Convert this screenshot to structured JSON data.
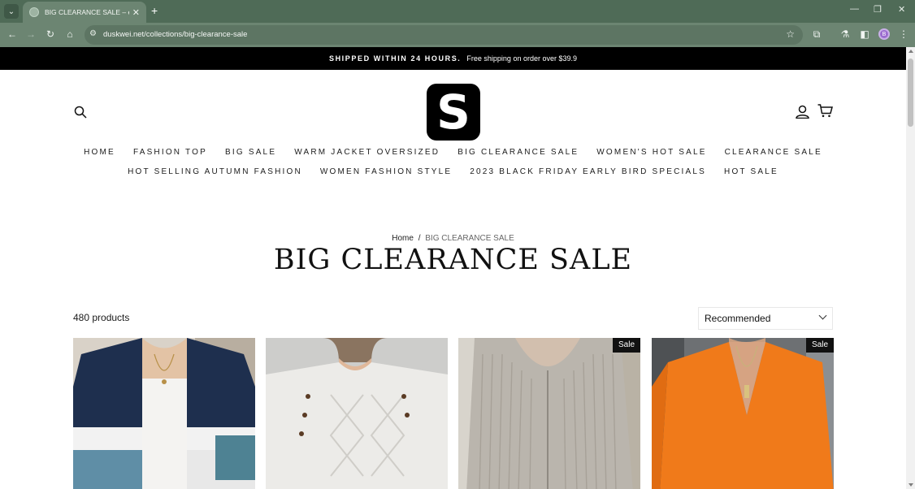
{
  "browser": {
    "tab_title": "BIG CLEARANCE SALE – establi",
    "url": "duskwei.net/collections/big-clearance-sale",
    "profile_initial": "B"
  },
  "announcement": {
    "bold_text": "SHIPPED WITHIN 24 HOURS.",
    "text": "Free shipping on order over $39.9"
  },
  "logo_letter": "S",
  "nav": {
    "row1": [
      "HOME",
      "FASHION TOP",
      "BIG SALE",
      "WARM JACKET OVERSIZED",
      "BIG CLEARANCE SALE",
      "WOMEN'S HOT SALE",
      "CLEARANCE SALE"
    ],
    "row2": [
      "HOT SELLING AUTUMN FASHION",
      "WOMEN FASHION STYLE",
      "2023 BLACK FRIDAY EARLY BIRD SPECIALS",
      "HOT SALE"
    ]
  },
  "breadcrumb": {
    "home": "Home",
    "separator": "/",
    "current": "BIG CLEARANCE SALE"
  },
  "page_title": "BIG CLEARANCE SALE",
  "product_count": "480 products",
  "sort": {
    "selected": "Recommended"
  },
  "products": [
    {
      "image": "navy and white striped cardigan",
      "badge": ""
    },
    {
      "image": "white cable knit sweater with buttons",
      "badge": ""
    },
    {
      "image": "grey ribbed zip hoodie",
      "badge": "Sale"
    },
    {
      "image": "orange v-neck sweater",
      "badge": "Sale"
    }
  ],
  "colors": {
    "chrome_dark": "#4f6b57",
    "chrome_light": "#6c8572",
    "announcement_bg": "#000000",
    "orange": "#f07a1a"
  }
}
